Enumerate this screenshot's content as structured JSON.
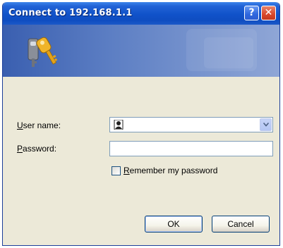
{
  "window": {
    "title": "Connect to 192.168.1.1"
  },
  "titlebar_buttons": {
    "help_label": "?",
    "close_label": "✕"
  },
  "form": {
    "user_name_label": "User name:",
    "user_name_value": "",
    "password_label": "Password:",
    "password_value": "",
    "remember_label": "Remember my password",
    "remember_checked": false
  },
  "buttons": {
    "ok_label": "OK",
    "cancel_label": "Cancel"
  },
  "icons": {
    "banner_icon": "keys-icon",
    "combo_icon": "user-icon",
    "dropdown_icon": "chevron-down-icon"
  },
  "colors": {
    "titlebar": "#0f4dc1",
    "dialog_bg": "#ece9d8",
    "close_button": "#d9472b"
  }
}
